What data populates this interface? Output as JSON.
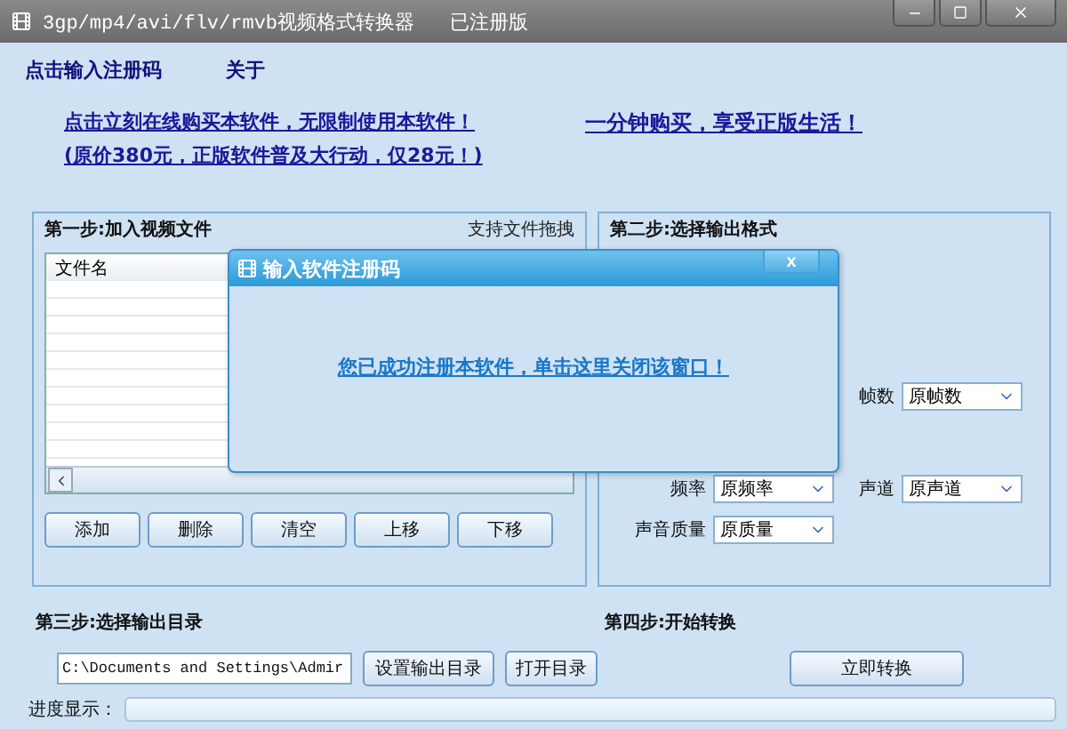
{
  "window": {
    "title": "3gp/mp4/avi/flv/rmvb视频格式转换器",
    "edition": "已注册版"
  },
  "menu": [
    "点击输入注册码",
    "关于"
  ],
  "promo_links": [
    "点击立刻在线购买本软件，无限制使用本软件！",
    "(原价380元，正版软件普及大行动，仅28元！)"
  ],
  "slogan_link": "一分钟购买，享受正版生活！",
  "step1": {
    "title": "第一步:加入视频文件",
    "hint": "支持文件拖拽",
    "column": "文件名",
    "buttons": [
      "添加",
      "删除",
      "清空",
      "上移",
      "下移"
    ]
  },
  "step2": {
    "title": "第二步:选择输出格式",
    "options": [
      {
        "label": "帧数",
        "value": "原帧数"
      },
      {
        "label": "频率",
        "value": "原频率"
      },
      {
        "label": "声道",
        "value": "原声道"
      },
      {
        "label": "声音质量",
        "value": "原质量"
      }
    ]
  },
  "step3": {
    "title": "第三步:选择输出目录",
    "path": "C:\\Documents and Settings\\Admir",
    "buttons": [
      "设置输出目录",
      "打开目录"
    ]
  },
  "step4": {
    "title": "第四步:开始转换",
    "button": "立即转换"
  },
  "progress": {
    "label": "进度显示：",
    "level": 0
  },
  "dialog": {
    "title": "输入软件注册码",
    "close": "x",
    "message": "您已成功注册本软件，单击这里关闭该窗口！"
  }
}
